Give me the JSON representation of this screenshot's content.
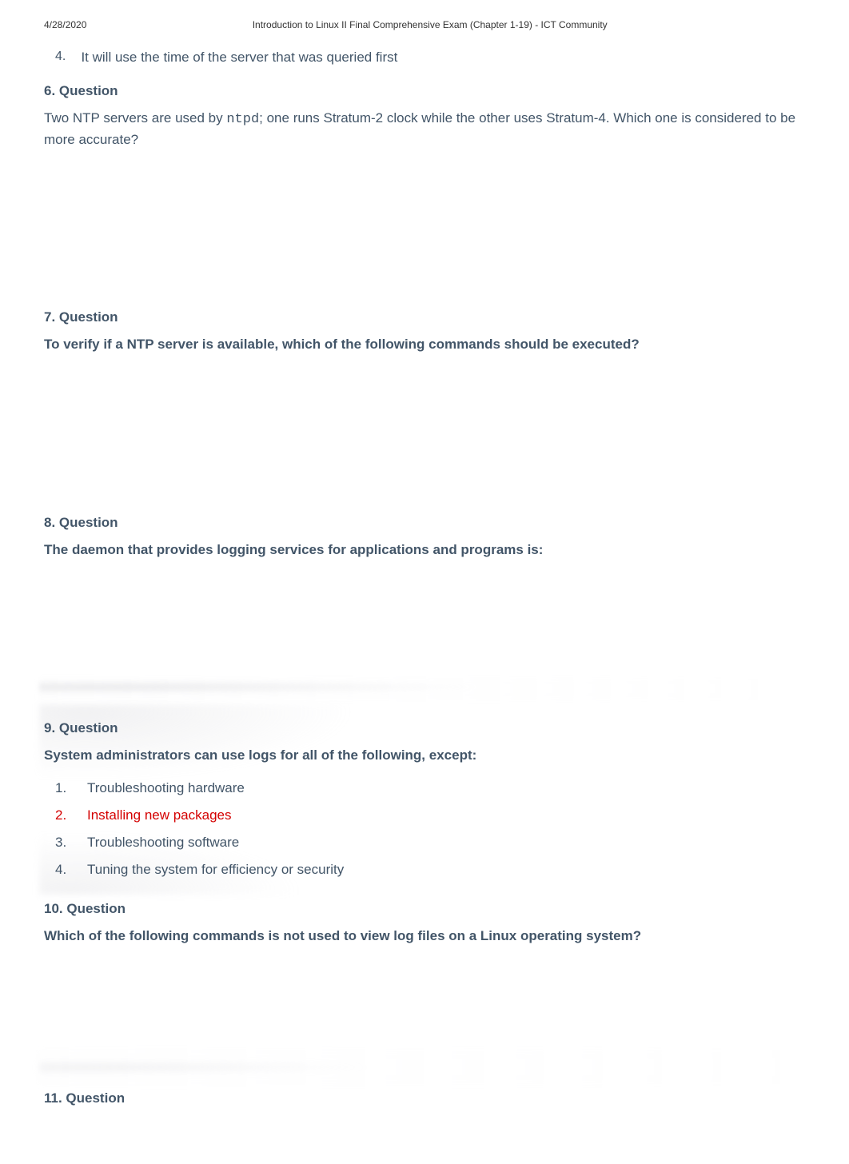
{
  "header": {
    "date": "4/28/2020",
    "title": "Introduction to Linux II Final Comprehensive Exam (Chapter 1-19) - ICT Community"
  },
  "orphan_item": {
    "num": "4.",
    "text": "It will use the time of the server that was queried first"
  },
  "q6": {
    "heading": "6. Question",
    "text_before_code": "Two NTP servers are used by ",
    "code": "ntpd",
    "text_after_code": "; one runs Stratum-2 clock while the other uses Stratum-4. Which one is considered to be more accurate?"
  },
  "q7": {
    "heading": "7. Question",
    "text": "To verify if a NTP server is available, which of the following commands should be executed?"
  },
  "q8": {
    "heading": "8. Question",
    "text": "The daemon that provides logging services for applications and programs is:"
  },
  "q9": {
    "heading": "9. Question",
    "text": "System administrators can use logs for all of the following, except:",
    "answers": [
      {
        "num": "1.",
        "text": "Troubleshooting hardware",
        "correct": false
      },
      {
        "num": "2.",
        "text": "Installing new packages",
        "correct": true
      },
      {
        "num": "3.",
        "text": "Troubleshooting software",
        "correct": false
      },
      {
        "num": "4.",
        "text": "Tuning the system for efficiency or security",
        "correct": false
      }
    ]
  },
  "q10": {
    "heading": "10. Question",
    "text": "Which of the following commands is not used to view log files on a Linux operating system?"
  },
  "q11": {
    "heading": "11. Question"
  }
}
